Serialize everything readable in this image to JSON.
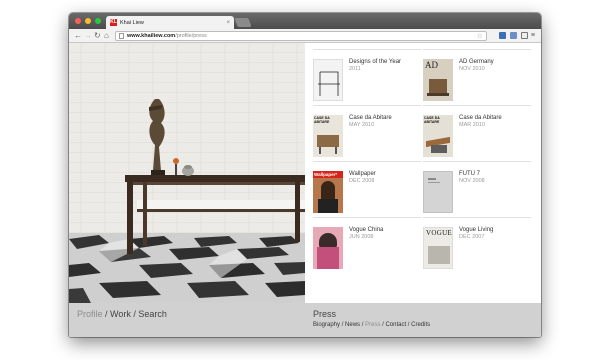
{
  "browser": {
    "tab_title": "Khai Liew",
    "favicon_text": "KL",
    "url_host": "www.khailiew.com",
    "url_path": "/profile/press"
  },
  "press_items": [
    {
      "title": "Designs of the Year",
      "date": "2011",
      "cover": "drawing"
    },
    {
      "title": "AD Germany",
      "date": "NOV 2010",
      "cover": "ad",
      "masthead": "AD"
    },
    {
      "title": "Case da Abitare",
      "date": "MAY 2010",
      "cover": "case",
      "masthead": "CASE DA ABITARE"
    },
    {
      "title": "Case da Abitare",
      "date": "MAR 2010",
      "cover": "case",
      "masthead": "CASE DA ABITARE"
    },
    {
      "title": "Wallpaper",
      "date": "DEC 2008",
      "cover": "wallpaper",
      "masthead": "Wallpaper*"
    },
    {
      "title": "FUTU 7",
      "date": "NOV 2008",
      "cover": "plain"
    },
    {
      "title": "Vogue China",
      "date": "JUN 2008",
      "cover": "vogue"
    },
    {
      "title": "Vogue Living",
      "date": "DEC 2007",
      "cover": "vogue-living",
      "masthead": "VOGUE"
    }
  ],
  "footer": {
    "left_profile": "Profile",
    "left_sep1": " / ",
    "left_work": "Work",
    "left_sep2": " / ",
    "left_search": "Search",
    "section_title": "Press",
    "nav_biography": "Biography",
    "nav_sep1": " / ",
    "nav_news": "News",
    "nav_sep2": " / ",
    "nav_press": "Press",
    "nav_sep3": " / ",
    "nav_contact": "Contact",
    "nav_sep4": " / ",
    "nav_credits": "Credits"
  },
  "colors": {
    "footer_bg": "#d1d1d1",
    "favicon": "#d81e1e",
    "wallpaper_red": "#d8241b"
  },
  "icons": [
    "back-icon",
    "forward-icon",
    "reload-icon",
    "home-icon",
    "page-icon",
    "star-icon",
    "menu-icon",
    "close-icon"
  ]
}
